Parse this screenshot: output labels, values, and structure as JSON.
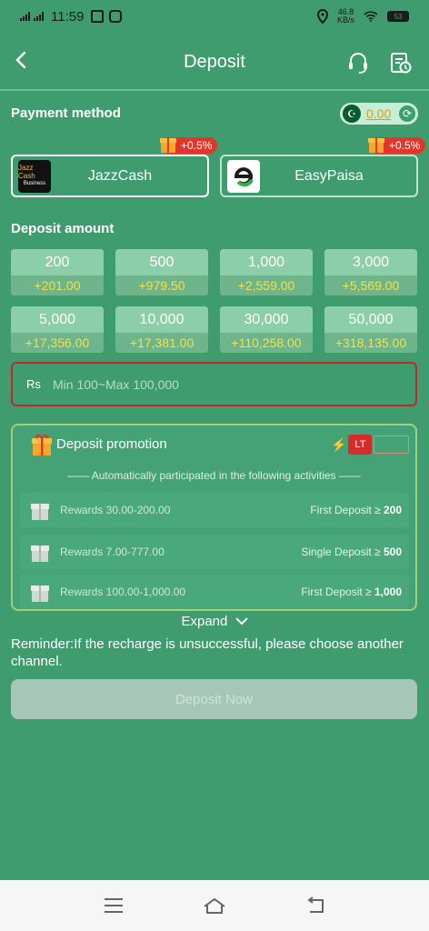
{
  "status_bar": {
    "time": "11:59",
    "net_speed_value": "46.8",
    "net_speed_unit": "KB/s",
    "battery": "53"
  },
  "header": {
    "title": "Deposit"
  },
  "payment": {
    "title": "Payment method",
    "balance": "0.00",
    "methods": [
      {
        "label": "JazzCash",
        "logo_text": "Jazz Cash",
        "logo_sub": "Business",
        "bonus": "+0.5%"
      },
      {
        "label": "EasyPaisa",
        "bonus": "+0.5%"
      }
    ]
  },
  "deposit": {
    "title": "Deposit amount",
    "amounts": [
      {
        "value": "200",
        "bonus": "+201.00"
      },
      {
        "value": "500",
        "bonus": "+979.50"
      },
      {
        "value": "1,000",
        "bonus": "+2,559.00"
      },
      {
        "value": "3,000",
        "bonus": "+5,569.00"
      },
      {
        "value": "5,000",
        "bonus": "+17,356.00"
      },
      {
        "value": "10,000",
        "bonus": "+17,381.00"
      },
      {
        "value": "30,000",
        "bonus": "+110,258.00"
      },
      {
        "value": "50,000",
        "bonus": "+318,135.00"
      }
    ],
    "currency": "Rs",
    "placeholder": "Min 100~Max 100,000"
  },
  "promotion": {
    "title": "Deposit promotion",
    "lt_badge": "LT",
    "subtitle": "Automatically participated in the following activities",
    "rows": [
      {
        "reward": "Rewards 30.00-200.00",
        "condition": "First Deposit ≥",
        "amount": "200"
      },
      {
        "reward": "Rewards 7.00-777.00",
        "condition": "Single Deposit ≥",
        "amount": "500"
      },
      {
        "reward": "Rewards 100.00-1,000.00",
        "condition": "First Deposit ≥",
        "amount": "1,000"
      }
    ],
    "expand_label": "Expand"
  },
  "reminder": "Reminder:If the recharge is unsuccessful, please choose another channel.",
  "submit_label": "Deposit Now",
  "colors": {
    "background": "#3e9c6f",
    "bonus_text": "#f4e04a",
    "badge": "#e2362c",
    "error_border": "#c4262b"
  }
}
